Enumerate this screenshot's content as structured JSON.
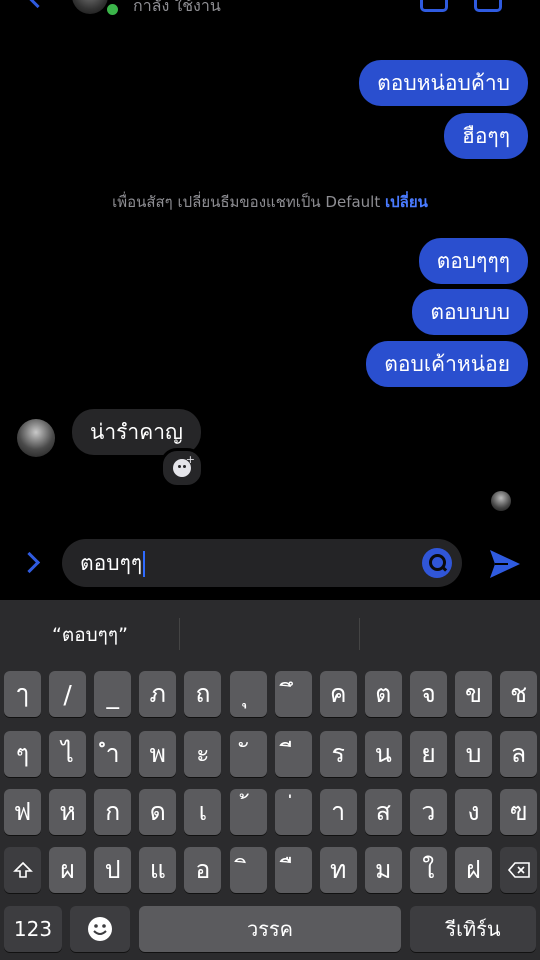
{
  "header": {
    "status": "กาลัง ใช้งาน"
  },
  "messages": {
    "m1": "ตอบหน่อบค้าบ",
    "m2": "ฮือๆๆ",
    "system_text": "เพื่อนสัสๆ เปลี่ยนธีมของแชทเป็น Default",
    "system_link": "เปลี่ยน",
    "m3": "ตอบๆๆๆ",
    "m4": "ตอบบบบ",
    "m5": "ตอบเค้าหน่อย",
    "incoming": "น่ารำคาญ"
  },
  "composer": {
    "text": "ตอบๆๆ"
  },
  "keyboard": {
    "suggestion": "“ตอบๆๆ”",
    "row1": [
      "ๅ",
      "/",
      "_",
      "ภ",
      "ถ",
      "ุ",
      "ึ",
      "ค",
      "ต",
      "จ",
      "ข",
      "ช"
    ],
    "row2": [
      "ๆ",
      "ไ",
      "ำ",
      "พ",
      "ะ",
      "ั",
      "ี",
      "ร",
      "น",
      "ย",
      "บ",
      "ล"
    ],
    "row3": [
      "ฟ",
      "ห",
      "ก",
      "ด",
      "เ",
      "้",
      "่",
      "า",
      "ส",
      "ว",
      "ง",
      "ฃ"
    ],
    "row4": [
      "ผ",
      "ป",
      "แ",
      "อ",
      "ิ",
      "ื",
      "ท",
      "ม",
      "ใ",
      "ฝ"
    ],
    "numbers_label": "123",
    "space_label": "วรรค",
    "return_label": "รีเทิร์น"
  }
}
